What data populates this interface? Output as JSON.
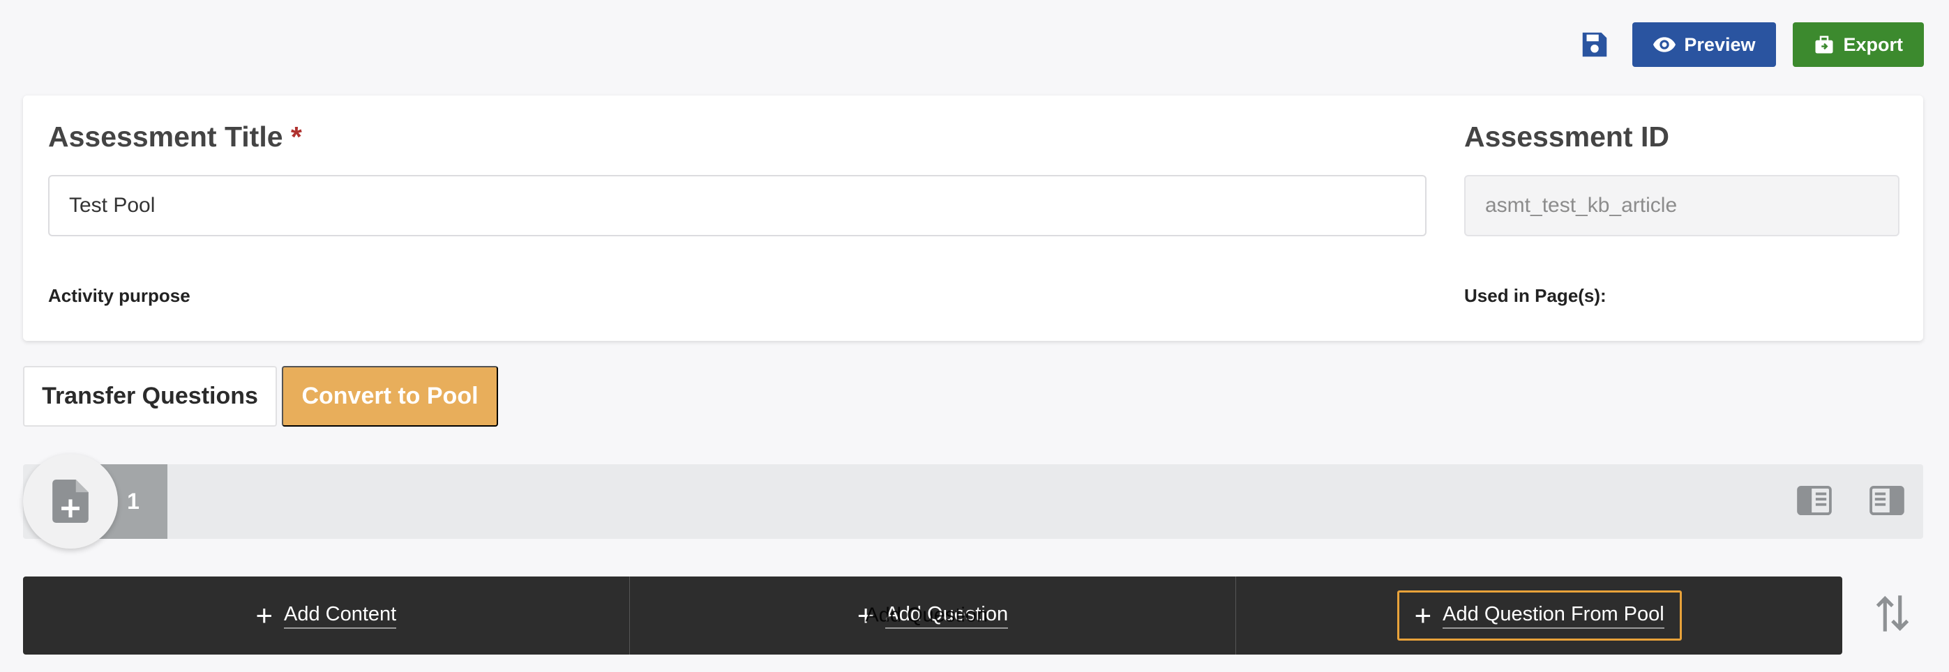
{
  "toolbar": {
    "save_icon": "save-icon",
    "preview_label": "Preview",
    "export_label": "Export",
    "colors": {
      "preview": "#2a54a0",
      "export": "#3c8a2e",
      "save": "#2a54a0"
    }
  },
  "assessment": {
    "title_label": "Assessment Title",
    "required_mark": "*",
    "title_value": "Test Pool",
    "id_label": "Assessment ID",
    "id_value": "asmt_test_kb_article",
    "purpose_label": "Activity purpose",
    "used_in_label": "Used in Page(s):"
  },
  "actions": {
    "transfer_label": "Transfer Questions",
    "convert_label": "Convert to Pool",
    "convert_color": "#e8ae5b"
  },
  "question_row": {
    "number": "1",
    "add_icon": "file-plus-icon",
    "layout_icons": [
      "layout-left-icon",
      "layout-right-icon"
    ]
  },
  "add_bar": {
    "add_content": "Add Content",
    "add_question": "Add Question",
    "add_question_ghost": "Add Question",
    "add_from_pool": "Add Question From Pool",
    "focus_color": "#e8a23a"
  }
}
